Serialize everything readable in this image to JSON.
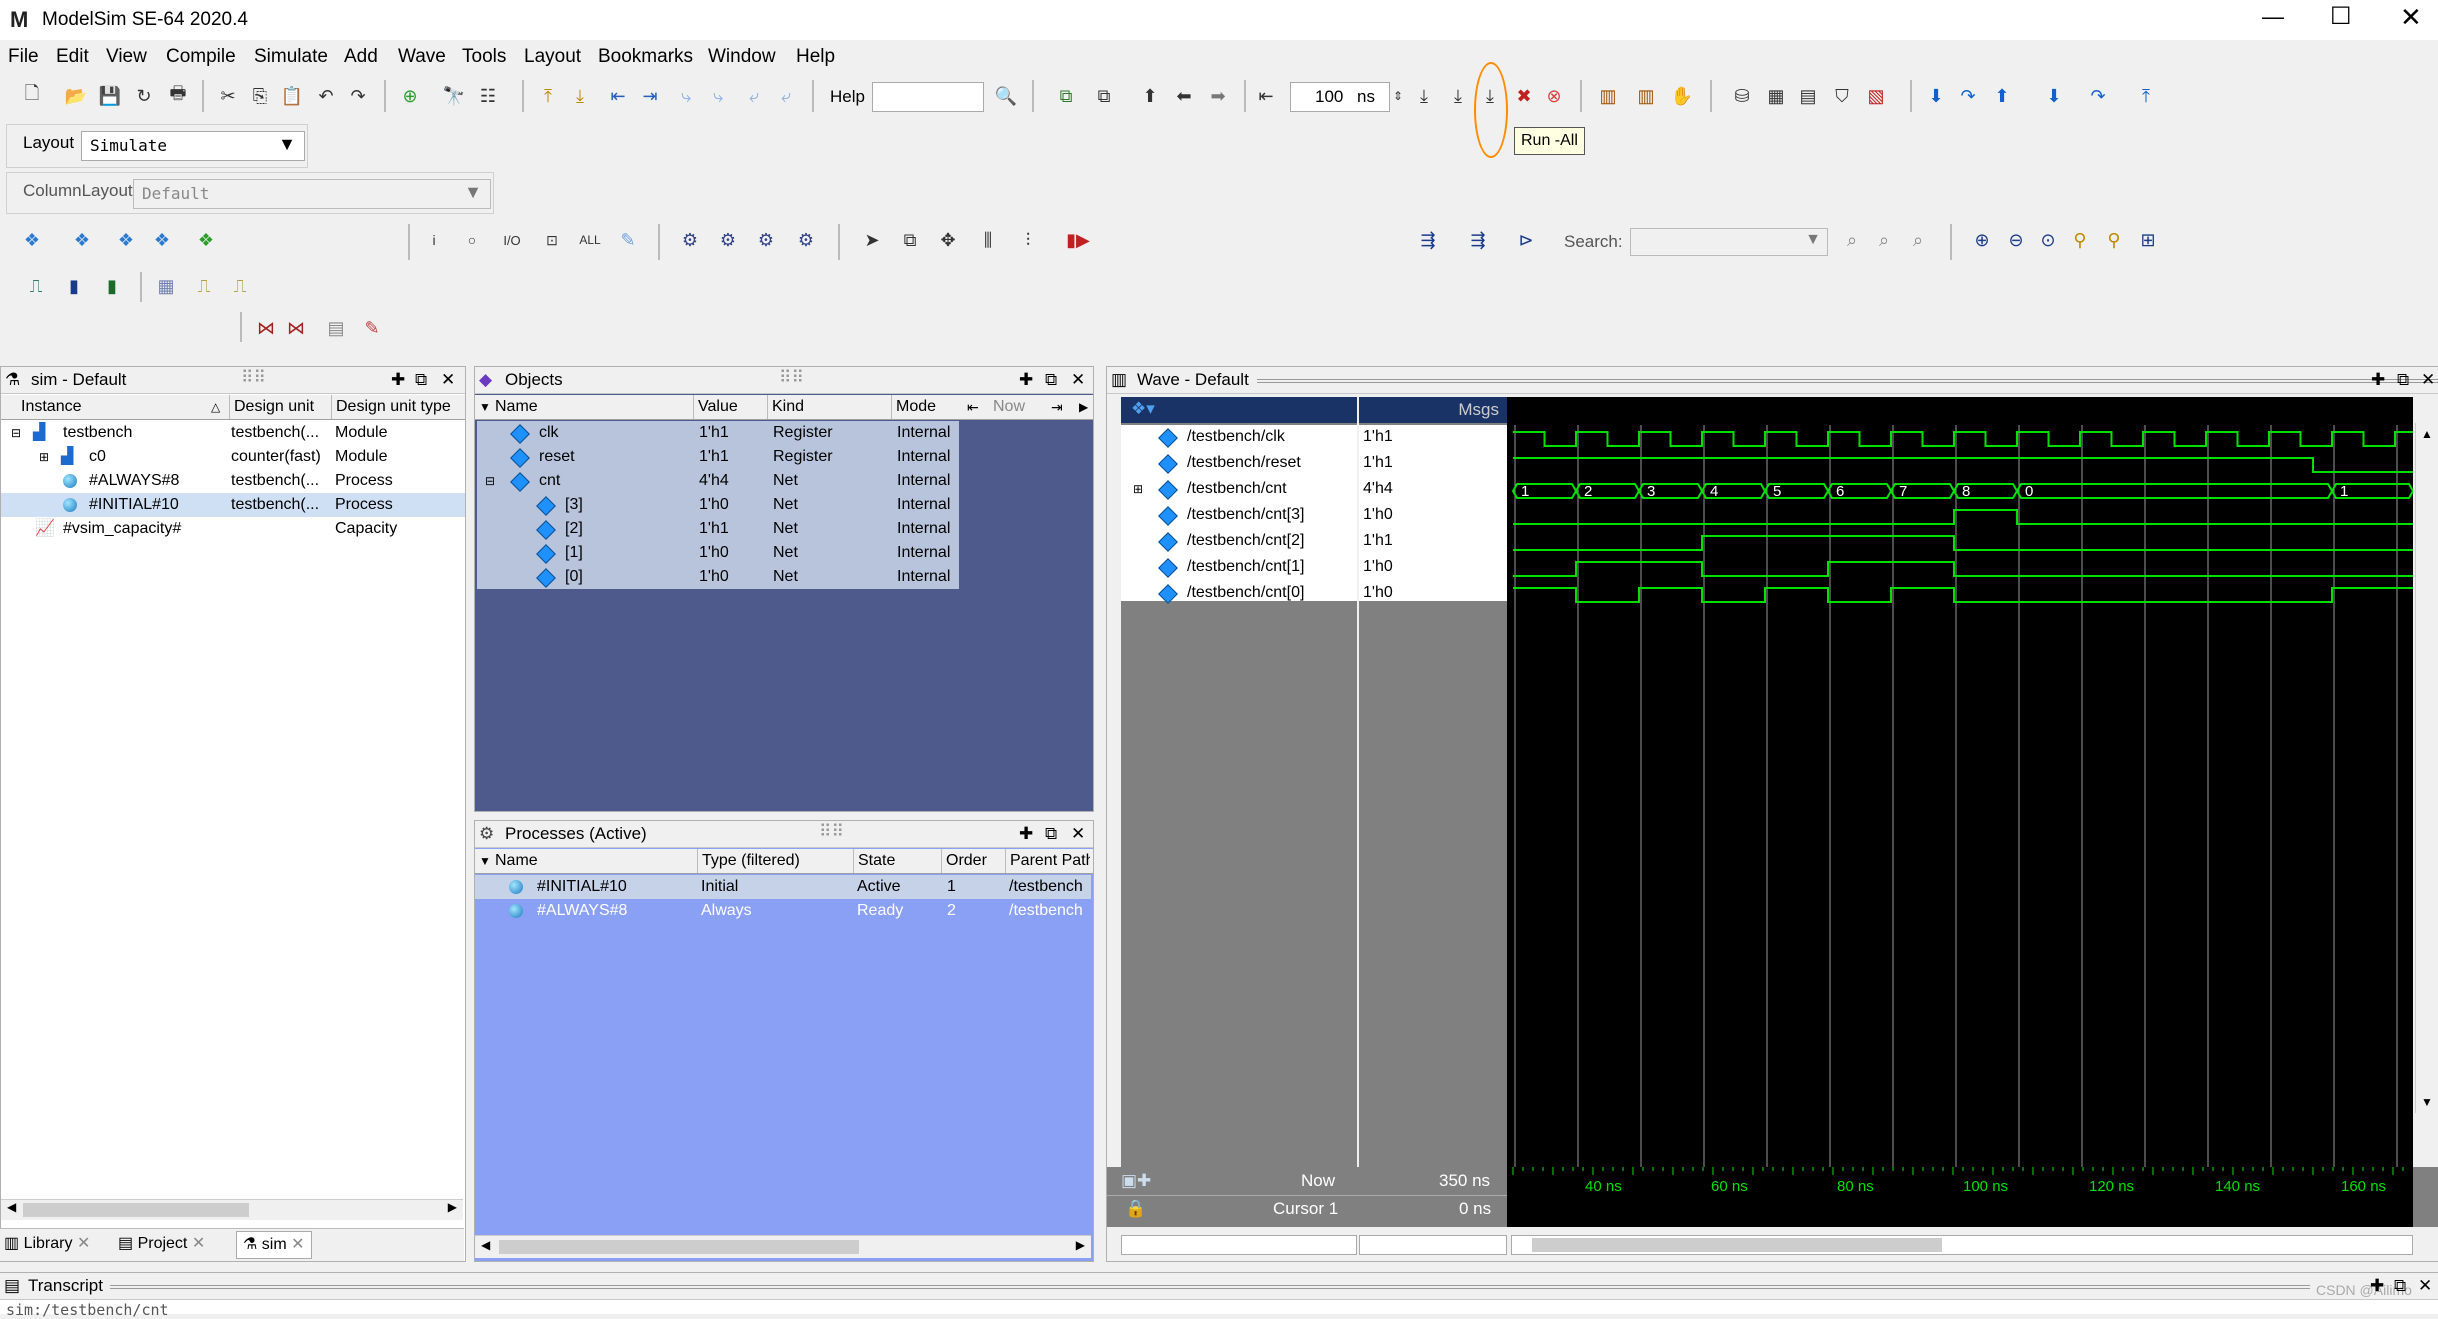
{
  "window": {
    "title": "ModelSim SE-64 2020.4",
    "logo": "M"
  },
  "menu": [
    "File",
    "Edit",
    "View",
    "Compile",
    "Simulate",
    "Add",
    "Wave",
    "Tools",
    "Layout",
    "Bookmarks",
    "Window",
    "Help"
  ],
  "toolbar": {
    "help_label": "Help",
    "run_length": "100",
    "run_unit": "ns",
    "tooltip": "Run -All"
  },
  "layout": {
    "label": "Layout",
    "value": "Simulate",
    "column_label": "ColumnLayout",
    "column_value": "Default"
  },
  "search": {
    "label": "Search:"
  },
  "sim_panel": {
    "title": "sim - Default",
    "columns": [
      "Instance",
      "Design unit",
      "Design unit type"
    ],
    "rows": [
      {
        "instance": "testbench",
        "unit": "testbench(...",
        "type": "Module"
      },
      {
        "instance": "c0",
        "unit": "counter(fast)",
        "type": "Module"
      },
      {
        "instance": "#ALWAYS#8",
        "unit": "testbench(...",
        "type": "Process"
      },
      {
        "instance": "#INITIAL#10",
        "unit": "testbench(...",
        "type": "Process"
      },
      {
        "instance": "#vsim_capacity#",
        "unit": "",
        "type": "Capacity"
      }
    ]
  },
  "objects_panel": {
    "title": "Objects",
    "columns": [
      "Name",
      "Value",
      "Kind",
      "Mode"
    ],
    "now_label": "Now",
    "rows": [
      {
        "name": "clk",
        "value": "1'h1",
        "kind": "Register",
        "mode": "Internal"
      },
      {
        "name": "reset",
        "value": "1'h1",
        "kind": "Register",
        "mode": "Internal"
      },
      {
        "name": "cnt",
        "value": "4'h4",
        "kind": "Net",
        "mode": "Internal"
      },
      {
        "name": "[3]",
        "value": "1'h0",
        "kind": "Net",
        "mode": "Internal"
      },
      {
        "name": "[2]",
        "value": "1'h1",
        "kind": "Net",
        "mode": "Internal"
      },
      {
        "name": "[1]",
        "value": "1'h0",
        "kind": "Net",
        "mode": "Internal"
      },
      {
        "name": "[0]",
        "value": "1'h0",
        "kind": "Net",
        "mode": "Internal"
      }
    ]
  },
  "processes_panel": {
    "title": "Processes (Active)",
    "columns": [
      "Name",
      "Type (filtered)",
      "State",
      "Order",
      "Parent Path"
    ],
    "rows": [
      {
        "name": "#INITIAL#10",
        "type": "Initial",
        "state": "Active",
        "order": "1",
        "parent": "/testbench"
      },
      {
        "name": "#ALWAYS#8",
        "type": "Always",
        "state": "Ready",
        "order": "2",
        "parent": "/testbench"
      }
    ]
  },
  "wave_panel": {
    "title": "Wave - Default",
    "msgs_label": "Msgs",
    "signals": [
      {
        "name": "/testbench/clk",
        "value": "1'h1"
      },
      {
        "name": "/testbench/reset",
        "value": "1'h1"
      },
      {
        "name": "/testbench/cnt",
        "value": "4'h4"
      },
      {
        "name": "/testbench/cnt[3]",
        "value": "1'h0"
      },
      {
        "name": "/testbench/cnt[2]",
        "value": "1'h1"
      },
      {
        "name": "/testbench/cnt[1]",
        "value": "1'h0"
      },
      {
        "name": "/testbench/cnt[0]",
        "value": "1'h0"
      }
    ],
    "cnt_labels": [
      "1",
      "2",
      "3",
      "4",
      "5",
      "6",
      "7",
      "8",
      "0",
      "1"
    ],
    "now_label": "Now",
    "now_value": "350 ns",
    "cursor_label": "Cursor 1",
    "cursor_value": "0 ns",
    "time_ticks": [
      "40 ns",
      "60 ns",
      "80 ns",
      "100 ns",
      "120 ns",
      "140 ns",
      "160 ns"
    ]
  },
  "bottom_tabs": [
    "Library",
    "Project",
    "sim"
  ],
  "transcript": {
    "title": "Transcript",
    "line": "sim:/testbench/cnt"
  },
  "watermark": "CSDN @Ailimo",
  "colors": {
    "objects_bg": "#4f5a8c",
    "processes_bg": "#8aa0f5",
    "wave_bg": "#000000",
    "wave_line": "#00e000",
    "highlight": "#ff8c00"
  }
}
